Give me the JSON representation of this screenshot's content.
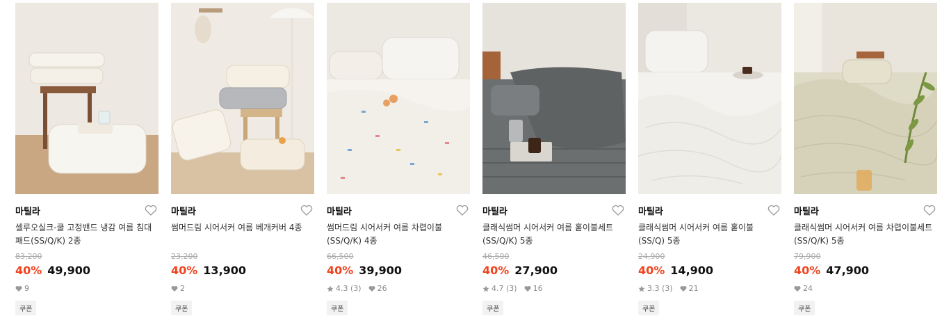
{
  "products": [
    {
      "brand": "마틸라",
      "title": "셀루오실크-쿨 고정밴드 냉감 여름 침대패드(SS/Q/K) 2종",
      "original_price": "83,200",
      "discount": "40%",
      "price": "49,900",
      "rating": "",
      "reviews": "",
      "likes": "9",
      "coupon": "쿠폰"
    },
    {
      "brand": "마틸라",
      "title": "썸머드림 시어서커 여름 베개커버 4종",
      "original_price": "23,200",
      "discount": "40%",
      "price": "13,900",
      "rating": "",
      "reviews": "",
      "likes": "2",
      "coupon": "쿠폰"
    },
    {
      "brand": "마틸라",
      "title": "썸머드림 시어서커 여름 차렵이불(SS/Q/K) 4종",
      "original_price": "66,500",
      "discount": "40%",
      "price": "39,900",
      "rating": "4.3",
      "reviews": "(3)",
      "likes": "26",
      "coupon": "쿠폰"
    },
    {
      "brand": "마틸라",
      "title": "클래식썸머 시어서커 여름 홑이불세트(SS/Q/K) 5종",
      "original_price": "46,500",
      "discount": "40%",
      "price": "27,900",
      "rating": "4.7",
      "reviews": "(3)",
      "likes": "16",
      "coupon": "쿠폰"
    },
    {
      "brand": "마틸라",
      "title": "클래식썸머 시어서커 여름 홑이불(SS/Q) 5종",
      "original_price": "24,900",
      "discount": "40%",
      "price": "14,900",
      "rating": "3.3",
      "reviews": "(3)",
      "likes": "21",
      "coupon": "쿠폰"
    },
    {
      "brand": "마틸라",
      "title": "클래식썸머 시어서커 여름 차렵이불세트(SS/Q/K) 5종",
      "original_price": "79,900",
      "discount": "40%",
      "price": "47,900",
      "rating": "",
      "reviews": "",
      "likes": "24",
      "coupon": "쿠폰"
    }
  ],
  "colors": {
    "discount": "#f0441f",
    "price": "#111111",
    "meta": "#888888",
    "coupon_bg": "#f2f2f2"
  },
  "icons": {
    "wishlist": "heart-outline-icon",
    "likes": "heart-filled-icon",
    "rating": "star-icon"
  }
}
